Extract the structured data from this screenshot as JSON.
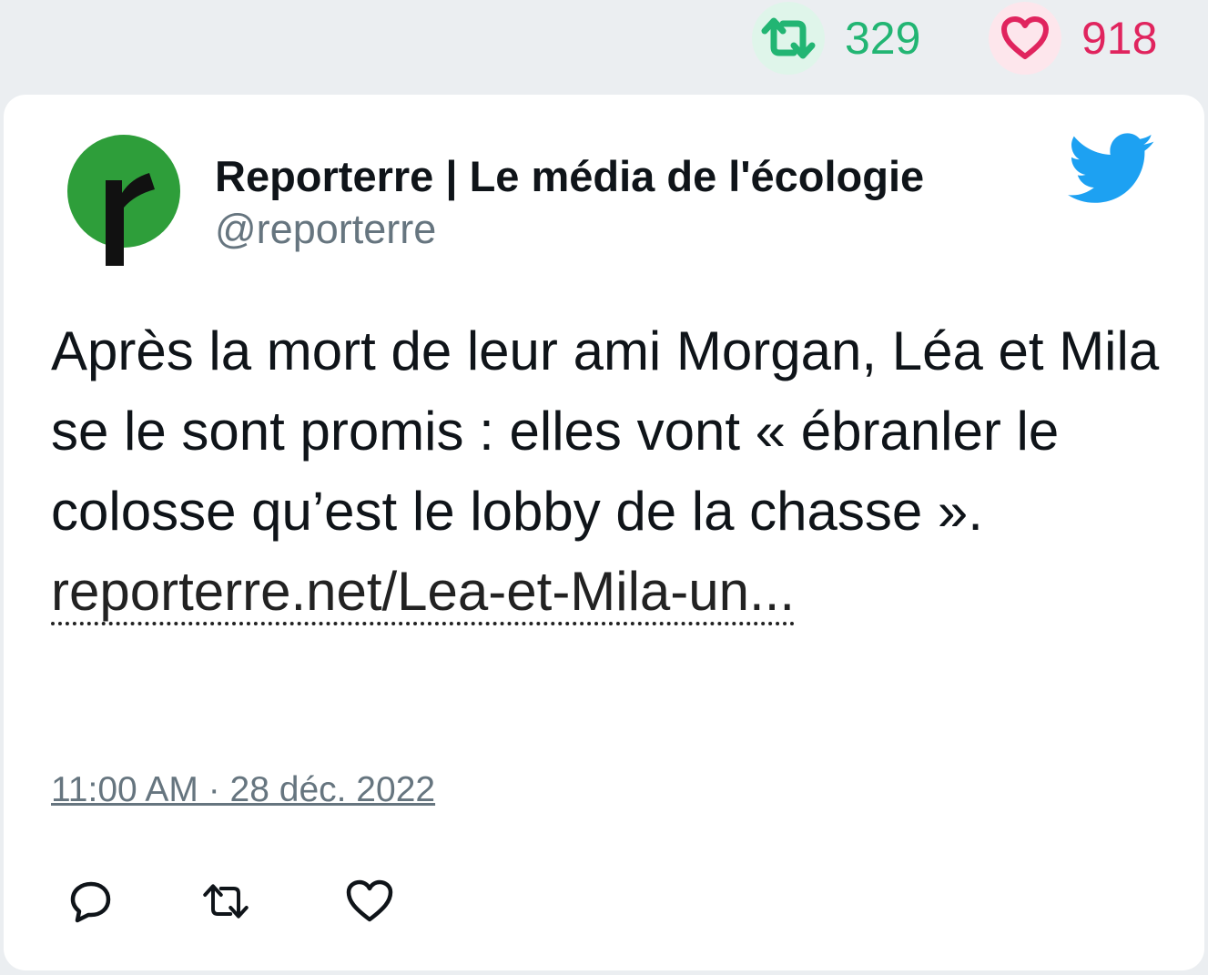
{
  "stats": {
    "retweet_count": "329",
    "like_count": "918",
    "retweet_icon": "retweet-icon",
    "like_icon": "heart-icon",
    "retweet_color": "#22b573",
    "like_color": "#e0245e"
  },
  "author": {
    "name": "Reporterre | Le média de l'écologie",
    "handle": "@reporterre",
    "avatar_color": "#2e9e3a"
  },
  "tweet": {
    "text": "Après la mort de leur ami Morgan, Léa et Mila se le sont promis : elles vont « ébranler le colosse qu’est le lobby de la chasse ». ",
    "link": "reporterre.net/Lea-et-Mila-un...",
    "timestamp": "11:00 AM · 28 déc. 2022"
  },
  "actions": {
    "reply_icon": "reply-icon",
    "retweet_icon": "retweet-icon",
    "like_icon": "heart-icon"
  },
  "brand": {
    "twitter_blue": "#1da1f2"
  }
}
